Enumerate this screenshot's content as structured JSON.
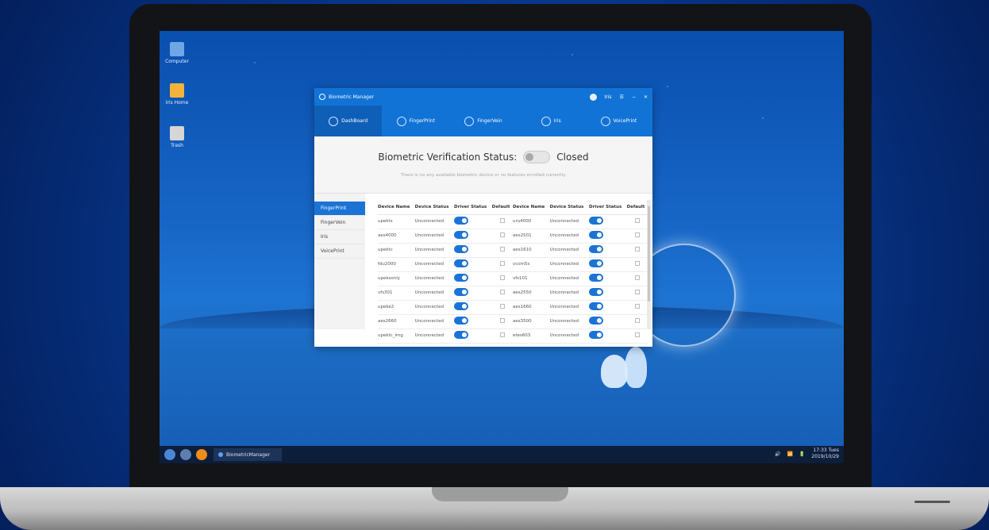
{
  "desktop": {
    "icons": [
      {
        "label": "Computer"
      },
      {
        "label": "Iris Home"
      },
      {
        "label": "Trash"
      }
    ]
  },
  "window": {
    "title": "Biometric Manager",
    "user": "Iris",
    "tabs": [
      {
        "label": "DashBoard"
      },
      {
        "label": "FingerPrint"
      },
      {
        "label": "FingerVein"
      },
      {
        "label": "Iris"
      },
      {
        "label": "VoicePrint"
      }
    ],
    "status": {
      "label": "Biometric Verification Status:",
      "value": "Closed",
      "hint": "There is no any available biometric device or no features enrolled currently."
    },
    "sidebar": [
      {
        "label": "FingerPrint"
      },
      {
        "label": "FingerVein"
      },
      {
        "label": "Iris"
      },
      {
        "label": "VoicePrint"
      }
    ],
    "table": {
      "headers": [
        "Device Name",
        "Device Status",
        "Driver Status",
        "Default",
        "Device Name",
        "Device Status",
        "Driver Status",
        "Default"
      ],
      "rows": [
        [
          "upekts",
          "Unconnected",
          "uru4000",
          "Unconnected"
        ],
        [
          "aes4000",
          "Unconnected",
          "aes2501",
          "Unconnected"
        ],
        [
          "upektc",
          "Unconnected",
          "aes1610",
          "Unconnected"
        ],
        [
          "fdu2000",
          "Unconnected",
          "vcom5s",
          "Unconnected"
        ],
        [
          "upeksonly",
          "Unconnected",
          "vfs101",
          "Unconnected"
        ],
        [
          "vfs301",
          "Unconnected",
          "aes2550",
          "Unconnected"
        ],
        [
          "upeke2",
          "Unconnected",
          "aes1660",
          "Unconnected"
        ],
        [
          "aes2660",
          "Unconnected",
          "aes3500",
          "Unconnected"
        ],
        [
          "upektc_img",
          "Unconnected",
          "etes603",
          "Unconnected"
        ]
      ]
    }
  },
  "taskbar": {
    "task_label": "BiometricManager",
    "time": "17:33 Tues",
    "date": "2019/10/29"
  }
}
